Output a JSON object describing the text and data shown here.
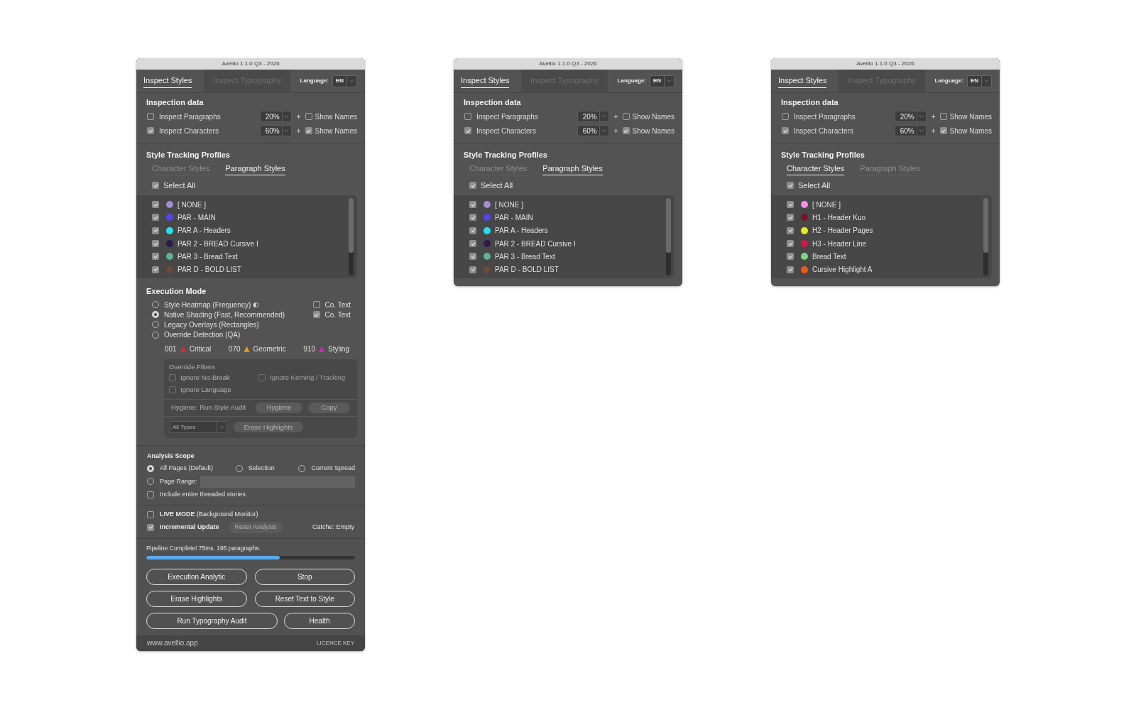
{
  "panels": [
    {
      "title": "Avellio 1.1.0 Q3 - 2026",
      "tabs": [
        {
          "label": "Inspect Styles",
          "selected": true
        },
        {
          "label": "Inspect Typography",
          "selected": false
        }
      ],
      "language": {
        "label": "Language:",
        "value": "EN"
      },
      "inspection_data": {
        "heading": "Inspection data",
        "rows": [
          {
            "label": "Inspect Paragraphs",
            "checked": false,
            "amount": "20%",
            "plus": "+",
            "names_label": "Show Names",
            "names_checked": false
          },
          {
            "label": "Inspect Characters",
            "checked": true,
            "amount": "60%",
            "plus": "+",
            "names_label": "Show Names",
            "names_checked": true
          }
        ]
      },
      "style_tracking": {
        "heading": "Style Tracking Profiles",
        "tabs": [
          {
            "label": "Character Styles",
            "selected": false
          },
          {
            "label": "Paragraph Styles",
            "selected": true
          }
        ],
        "select_all": {
          "label": "Select All",
          "checked": true
        },
        "styles": [
          {
            "label": "[ NONE ]",
            "checked": true,
            "color": "#a68ad2"
          },
          {
            "label": "PAR - MAIN",
            "checked": true,
            "color": "#5246e8"
          },
          {
            "label": "PAR A - Headers",
            "checked": true,
            "color": "#1fe3f0"
          },
          {
            "label": "PAR 2 - BREAD Cursive I",
            "checked": true,
            "color": "#2e1a4c"
          },
          {
            "label": "PAR 3 - Bread Text",
            "checked": true,
            "color": "#5fb196"
          },
          {
            "label": "PAR D - BOLD LIST",
            "checked": true,
            "color": "#6a4a3b"
          }
        ]
      },
      "execution_mode": {
        "heading": "Execution Mode",
        "modes": [
          {
            "label": "Style Heatmap (Frequency)",
            "glyph": "◐",
            "selected": false
          },
          {
            "label": "Native Shading (Fast, Recommended)",
            "selected": true
          },
          {
            "label": "Legacy Overlays (Rectangles)",
            "selected": false
          },
          {
            "label": "Override Detection (QA)",
            "selected": false
          }
        ],
        "options": [
          {
            "label": "Co. Text",
            "checked": false
          },
          {
            "label": "Co. Text",
            "checked": true
          }
        ],
        "counts": [
          {
            "count": "001",
            "label": "Critical",
            "color": "#e8262a"
          },
          {
            "count": "070",
            "label": "Geometric",
            "color": "#f29a1a"
          },
          {
            "count": "910",
            "label": "Styling",
            "color": "#d920c4"
          }
        ],
        "override_filters": {
          "heading": "Override Filters",
          "disabled": true,
          "options": [
            {
              "label": "Ignore No-Break",
              "checked": false,
              "disabled": false
            },
            {
              "label": "Ignore Kerning / Tracking",
              "checked": false,
              "disabled": true
            },
            {
              "label": "Ignore Language",
              "checked": false,
              "disabled": false
            }
          ],
          "hygiene": {
            "label": "Hygiene: Run Style Audit",
            "buttons": [
              "Hygiene",
              "Copy"
            ]
          },
          "type_select": "All Types",
          "erase_button": "Erase Highlights"
        }
      },
      "analysis_scope": {
        "heading": "Analysis Scope",
        "options": [
          {
            "label": "All Pages (Default)",
            "selected": true
          },
          {
            "label": "Selection",
            "selected": false
          },
          {
            "label": "Current Spread",
            "selected": false
          }
        ],
        "page_range": {
          "label": "Page Range:",
          "selected": false
        },
        "threaded": {
          "label": "Include entire threaded stories",
          "checked": false
        }
      },
      "monitor": {
        "live_mode": {
          "label": "**LIVE MODE** (Background Monitor)",
          "checked": false
        },
        "incremental": {
          "label": "Incremental Update",
          "checked": true
        },
        "reset_button": {
          "label": "Reset Analysis",
          "disabled": true
        },
        "cache": "Catche: Empty"
      },
      "pipeline": {
        "status": "Pipeline Complete! 75ms. 195 paragraphs.",
        "level": 0.64
      },
      "button_rows": [
        {
          "buttons": [
            "Execution Analytic",
            "Stop"
          ]
        },
        {
          "buttons": [
            "Erase Highlights",
            "Reset Text to Style"
          ]
        },
        {
          "buttons": [
            "Run Typography Audit",
            "Health"
          ]
        }
      ],
      "footer": {
        "website": "www.avellio.app",
        "licence": "LICENCE KEY"
      }
    },
    {
      "title": "Avellio 1.1.0 Q3 - 2026",
      "tabs": [
        {
          "label": "Inspect Styles",
          "selected": true
        },
        {
          "label": "Inspect Typography",
          "selected": false
        }
      ],
      "language": {
        "label": "Language:",
        "value": "EN"
      },
      "inspection_data": {
        "heading": "Inspection data",
        "rows": [
          {
            "label": "Inspect Paragraphs",
            "checked": false,
            "amount": "20%",
            "plus": "+",
            "names_label": "Show Names",
            "names_checked": false
          },
          {
            "label": "Inspect Characters",
            "checked": true,
            "amount": "60%",
            "plus": "+",
            "names_label": "Show Names",
            "names_checked": true
          }
        ]
      },
      "style_tracking": {
        "heading": "Style Tracking Profiles",
        "tabs": [
          {
            "label": "Character Styles",
            "selected": false
          },
          {
            "label": "Paragraph Styles",
            "selected": true
          }
        ],
        "select_all": {
          "label": "Select All",
          "checked": true
        },
        "styles": [
          {
            "label": "[ NONE ]",
            "checked": true,
            "color": "#a68ad2"
          },
          {
            "label": "PAR - MAIN",
            "checked": true,
            "color": "#5246e8"
          },
          {
            "label": "PAR A - Headers",
            "checked": true,
            "color": "#1fe3f0"
          },
          {
            "label": "PAR 2 - BREAD Cursive I",
            "checked": true,
            "color": "#2e1a4c"
          },
          {
            "label": "PAR 3 - Bread Text",
            "checked": true,
            "color": "#5fb196"
          },
          {
            "label": "PAR D - BOLD LIST",
            "checked": true,
            "color": "#6a4a3b"
          }
        ]
      }
    },
    {
      "title": "Avellio 1.1.0 Q3 - 2026",
      "tabs": [
        {
          "label": "Inspect Styles",
          "selected": true
        },
        {
          "label": "Inspect Typography",
          "selected": false
        }
      ],
      "language": {
        "label": "Language:",
        "value": "EN"
      },
      "inspection_data": {
        "heading": "Inspection data",
        "rows": [
          {
            "label": "Inspect Paragraphs",
            "checked": false,
            "amount": "20%",
            "plus": "+",
            "names_label": "Show Names",
            "names_checked": false
          },
          {
            "label": "Inspect Characters",
            "checked": true,
            "amount": "60%",
            "plus": "+",
            "names_label": "Show Names",
            "names_checked": true
          }
        ]
      },
      "style_tracking": {
        "heading": "Style Tracking Profiles",
        "tabs": [
          {
            "label": "Character Styles",
            "selected": true
          },
          {
            "label": "Paragraph Styles",
            "selected": false
          }
        ],
        "select_all": {
          "label": "Select All",
          "checked": true
        },
        "styles": [
          {
            "label": "[ NONE ]",
            "checked": true,
            "color": "#f590e2"
          },
          {
            "label": "H1 - Header Kuo",
            "checked": true,
            "color": "#7a1426"
          },
          {
            "label": "H2 - Header Pages",
            "checked": true,
            "color": "#e4ee12"
          },
          {
            "label": "H3 - Header Line",
            "checked": true,
            "color": "#e0104c"
          },
          {
            "label": "Bread Text",
            "checked": true,
            "color": "#7ed37e"
          },
          {
            "label": "Cursive Highlight A",
            "checked": true,
            "color": "#f05a12"
          }
        ]
      }
    }
  ]
}
